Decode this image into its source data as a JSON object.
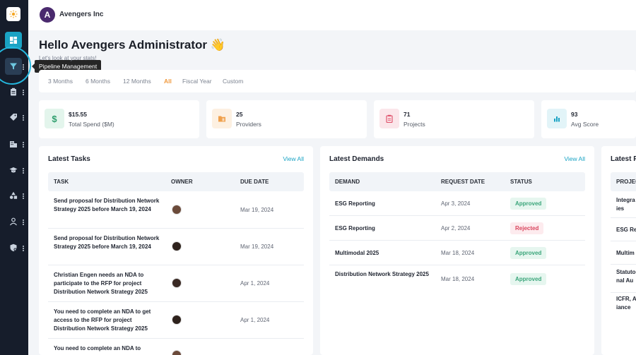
{
  "org": {
    "name": "Avengers Inc",
    "avatar_letter": "A"
  },
  "greeting": {
    "title": "Hello Avengers Administrator 👋",
    "subtitle": "Let's look at your stats!"
  },
  "tooltip": "Pipeline Management",
  "filters": [
    "3 Months",
    "6 Months",
    "12 Months",
    "All",
    "Fiscal Year",
    "Custom"
  ],
  "active_filter": "All",
  "stats": [
    {
      "value": "$15.55",
      "label": "Total Spend ($M)",
      "icon": "dollar-icon",
      "color": "#2f9e6e"
    },
    {
      "value": "25",
      "label": "Providers",
      "icon": "folder-icon",
      "color": "#f0a04b"
    },
    {
      "value": "71",
      "label": "Projects",
      "icon": "clipboard-icon",
      "color": "#e0566f"
    },
    {
      "value": "93",
      "label": "Avg Score",
      "icon": "bar-chart-icon",
      "color": "#1aa3c4"
    }
  ],
  "tasks": {
    "title": "Latest Tasks",
    "view_all": "View All",
    "headers": [
      "TASK",
      "OWNER",
      "DUE DATE"
    ],
    "rows": [
      {
        "task": "Send proposal for Distribution Network Strategy 2025 before March 19, 2024",
        "due": "Mar 19, 2024"
      },
      {
        "task": "Send proposal for Distribution Network Strategy 2025 before March 19, 2024",
        "due": "Mar 19, 2024"
      },
      {
        "task": "Christian Engen needs an NDA to participate to the RFP for project Distribution Network Strategy 2025",
        "due": "Apr 1, 2024"
      },
      {
        "task": "You need to complete an NDA to get access to the RFP for project Distribution Network Strategy 2025",
        "due": "Apr 1, 2024"
      },
      {
        "task": "You need to complete an NDA to",
        "due": ""
      }
    ]
  },
  "demands": {
    "title": "Latest Demands",
    "view_all": "View All",
    "headers": [
      "DEMAND",
      "REQUEST DATE",
      "STATUS"
    ],
    "rows": [
      {
        "demand": "ESG Reporting",
        "date": "Apr 3, 2024",
        "status": "Approved"
      },
      {
        "demand": "ESG Reporting",
        "date": "Apr 2, 2024",
        "status": "Rejected"
      },
      {
        "demand": "Multimodal 2025",
        "date": "Mar 18, 2024",
        "status": "Approved"
      },
      {
        "demand": "Distribution Network Strategy 2025",
        "date": "Mar 18, 2024",
        "status": "Approved"
      }
    ]
  },
  "projects": {
    "title": "Latest P",
    "header": "PROJEC",
    "rows": [
      "Integra ies",
      "ESG Re",
      "Multim",
      "Statuto nal Au",
      "ICFR, A iance"
    ]
  }
}
